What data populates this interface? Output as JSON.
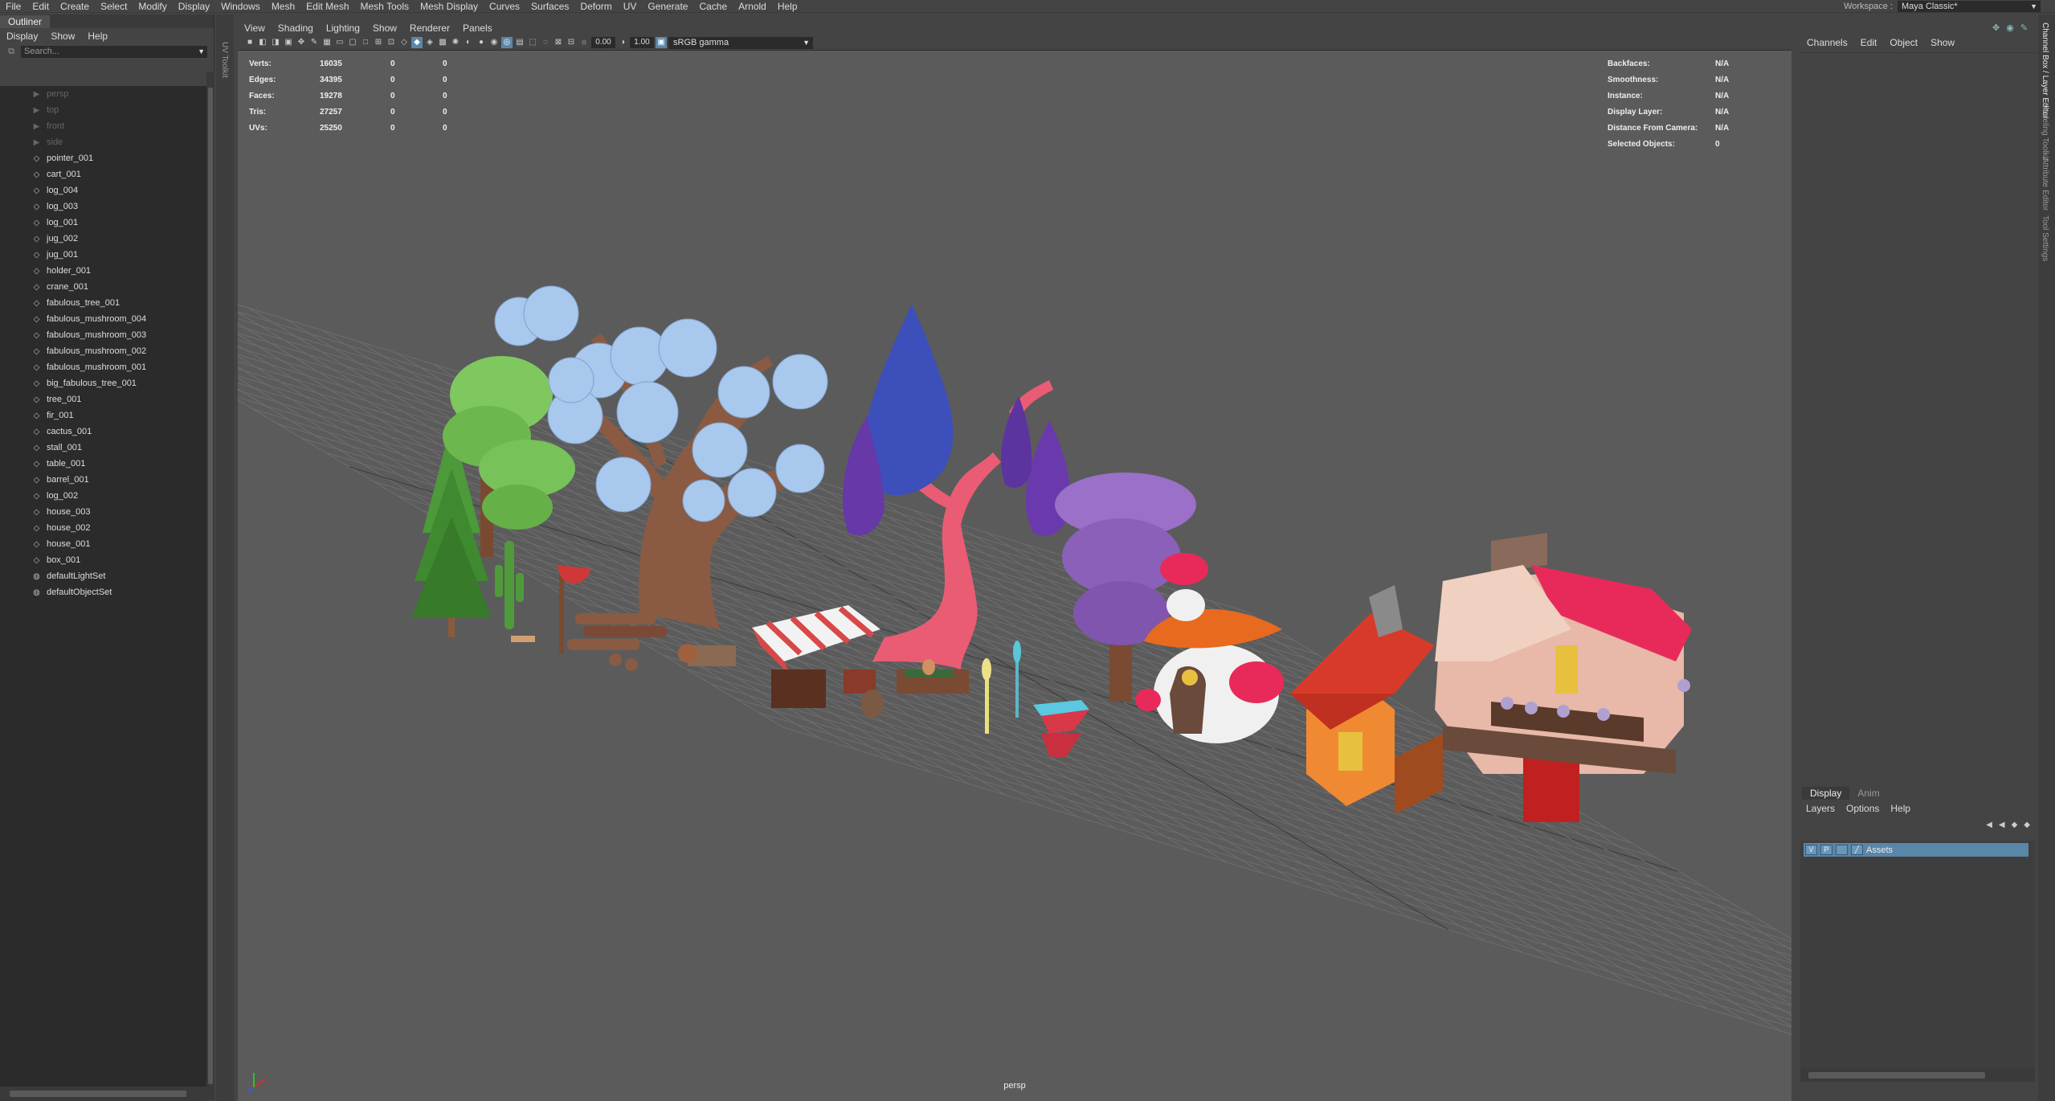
{
  "menubar": [
    "File",
    "Edit",
    "Create",
    "Select",
    "Modify",
    "Display",
    "Windows",
    "Mesh",
    "Edit Mesh",
    "Mesh Tools",
    "Mesh Display",
    "Curves",
    "Surfaces",
    "Deform",
    "UV",
    "Generate",
    "Cache",
    "Arnold",
    "Help"
  ],
  "workspace": {
    "label": "Workspace :",
    "value": "Maya Classic*"
  },
  "outliner": {
    "title": "Outliner",
    "menu": [
      "Display",
      "Show",
      "Help"
    ],
    "search_placeholder": "Search...",
    "items": [
      {
        "label": "persp",
        "type": "camera"
      },
      {
        "label": "top",
        "type": "camera"
      },
      {
        "label": "front",
        "type": "camera"
      },
      {
        "label": "side",
        "type": "camera"
      },
      {
        "label": "pointer_001",
        "type": "mesh"
      },
      {
        "label": "cart_001",
        "type": "mesh"
      },
      {
        "label": "log_004",
        "type": "mesh"
      },
      {
        "label": "log_003",
        "type": "mesh"
      },
      {
        "label": "log_001",
        "type": "mesh"
      },
      {
        "label": "jug_002",
        "type": "mesh"
      },
      {
        "label": "jug_001",
        "type": "mesh"
      },
      {
        "label": "holder_001",
        "type": "mesh"
      },
      {
        "label": "crane_001",
        "type": "mesh"
      },
      {
        "label": "fabulous_tree_001",
        "type": "mesh"
      },
      {
        "label": "fabulous_mushroom_004",
        "type": "mesh"
      },
      {
        "label": "fabulous_mushroom_003",
        "type": "mesh"
      },
      {
        "label": "fabulous_mushroom_002",
        "type": "mesh"
      },
      {
        "label": "fabulous_mushroom_001",
        "type": "mesh"
      },
      {
        "label": "big_fabulous_tree_001",
        "type": "mesh"
      },
      {
        "label": "tree_001",
        "type": "mesh"
      },
      {
        "label": "fir_001",
        "type": "mesh"
      },
      {
        "label": "cactus_001",
        "type": "mesh"
      },
      {
        "label": "stall_001",
        "type": "mesh"
      },
      {
        "label": "table_001",
        "type": "mesh"
      },
      {
        "label": "barrel_001",
        "type": "mesh"
      },
      {
        "label": "log_002",
        "type": "mesh"
      },
      {
        "label": "house_003",
        "type": "mesh"
      },
      {
        "label": "house_002",
        "type": "mesh"
      },
      {
        "label": "house_001",
        "type": "mesh"
      },
      {
        "label": "box_001",
        "type": "mesh"
      },
      {
        "label": "defaultLightSet",
        "type": "set"
      },
      {
        "label": "defaultObjectSet",
        "type": "set"
      }
    ]
  },
  "side_tab": "UV Toolkit",
  "viewport": {
    "menu": [
      "View",
      "Shading",
      "Lighting",
      "Show",
      "Renderer",
      "Panels"
    ],
    "exposure": "0.00",
    "gamma_value": "1.00",
    "color_space": "sRGB gamma",
    "camera": "persp",
    "hud_left": [
      {
        "label": "Verts:",
        "a": "16035",
        "b": "0",
        "c": "0"
      },
      {
        "label": "Edges:",
        "a": "34395",
        "b": "0",
        "c": "0"
      },
      {
        "label": "Faces:",
        "a": "19278",
        "b": "0",
        "c": "0"
      },
      {
        "label": "Tris:",
        "a": "27257",
        "b": "0",
        "c": "0"
      },
      {
        "label": "UVs:",
        "a": "25250",
        "b": "0",
        "c": "0"
      }
    ],
    "hud_right": [
      {
        "label": "Backfaces:",
        "value": "N/A"
      },
      {
        "label": "Smoothness:",
        "value": "N/A"
      },
      {
        "label": "Instance:",
        "value": "N/A"
      },
      {
        "label": "Display Layer:",
        "value": "N/A"
      },
      {
        "label": "Distance From Camera:",
        "value": "N/A"
      },
      {
        "label": "Selected Objects:",
        "value": "0"
      }
    ]
  },
  "channelbox": {
    "menu": [
      "Channels",
      "Edit",
      "Object",
      "Show"
    ]
  },
  "layereditor": {
    "tabs": [
      "Display",
      "Anim"
    ],
    "menu": [
      "Layers",
      "Options",
      "Help"
    ],
    "layer": {
      "v": "V",
      "p": "P",
      "name": "Assets"
    }
  },
  "right_tabs": [
    "Channel Box / Layer Editor",
    "Modeling Toolkit",
    "Attribute Editor",
    "Tool Settings"
  ],
  "colors": {
    "accent": "#5a86a8",
    "viewport_bg": "#5b5b5b",
    "panel": "#444444",
    "field": "#2b2b2b"
  }
}
